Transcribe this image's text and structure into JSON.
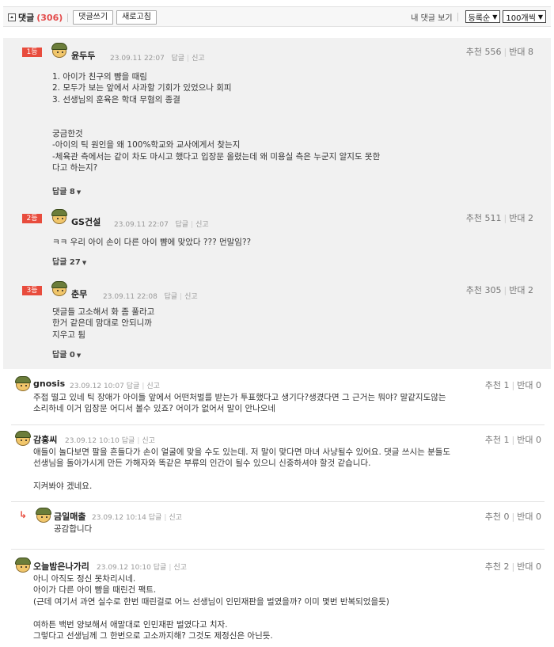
{
  "header": {
    "title": "댓글",
    "count": "(306)",
    "write_label": "댓글쓰기",
    "refresh_label": "새로고침",
    "my_comments_label": "내 댓글 보기",
    "sort_selected": "등록순",
    "per_page_selected": "100개씩"
  },
  "best": [
    {
      "rank": "1등",
      "nick": "윤두두",
      "date": "23.09.11 22:07",
      "reply": "답글",
      "report": "신고",
      "up": "추천 556",
      "down": "반대 8",
      "body": "1. 아이가 친구의 뺨을 때림\n2. 모두가 보는 앞에서 사과할 기회가 있었으나 회피\n3. 선생님의 훈육은 학대 무혐의 종결\n\n\n궁금한것\n-아이의 틱 원인을 왜 100%학교와 교사에게서 찾는지\n-체육관 측에서는 같이 차도 마시고 했다고 입장문 올렸는데 왜 미용실 측은 누군지 알지도 못한\n다고 하는지?",
      "reply_count": "답글 8"
    },
    {
      "rank": "2등",
      "nick": "GS건설",
      "date": "23.09.11 22:07",
      "reply": "답글",
      "report": "신고",
      "up": "추천 511",
      "down": "반대 2",
      "body": "ㅋㅋ 우리 아이 손이 다른 아이 뺨에 맞았다 ??? 먼말임??",
      "reply_count": "답글 27"
    },
    {
      "rank": "3등",
      "nick": "춘무",
      "date": "23.09.11 22:08",
      "reply": "답글",
      "report": "신고",
      "up": "추천 305",
      "down": "반대 2",
      "body": "댓글들 고소해서 화 좀 풀라고\n한거 같은데 맘대로 안되니까\n지우고 튐",
      "reply_count": "답글 0"
    }
  ],
  "comments": [
    {
      "nick": "gnosis",
      "date": "23.09.12 10:07",
      "reply": "답글",
      "report": "신고",
      "up": "추천 1",
      "down": "반대 0",
      "body": "주접 떨고 있네 틱 장애가 아이들 앞에서 어떤처벌를 받는가 투표했다고 생기다?생겼다면 그 근거는 뭐야? 말같지도않는\n소리하네 이거 입장문 어디서 볼수 있죠? 어이가 없어서 말이 안나오네"
    },
    {
      "nick": "감홍씨",
      "date": "23.09.12 10:10",
      "reply": "답글",
      "report": "신고",
      "up": "추천 1",
      "down": "반대 0",
      "body": "애들이 놀다보면 팔을 흔들다가 손이 얼굴에 맞을 수도 있는데. 저 말이 맞다면 마녀 사냥될수 있어요. 댓글 쓰시는 분들도\n선생님을 돌아가시게 만든 가해자와 똑같은 부류의 인간이 될수 있으니 신중하셔야 할것 같습니다.\n\n지켜봐야 겠네요."
    },
    {
      "nick": "금일매출",
      "date": "23.09.12 10:14",
      "reply": "답글",
      "report": "신고",
      "up": "추천 0",
      "down": "반대 0",
      "body": "공감합니다"
    },
    {
      "nick": "오늘밤은나가리",
      "date": "23.09.12 10:10",
      "reply": "답글",
      "report": "신고",
      "up": "추천 2",
      "down": "반대 0",
      "body": "아니 아직도 정신 못차리시네.\n아이가 다른 아이 뺨을 때린건 팩트.\n(근데 여기서 과연 실수로 한번 때린걸로 어느 선생님이 인민재판을 벌였을까? 이미 몇번 반복되었을듯)\n\n여하튼 백번 양보해서 애말대로 인민재판 벌였다고 치자.\n그렇다고 선생님께 그 한번으로 고소까지해? 그것도 제정신은 아닌듯."
    }
  ]
}
